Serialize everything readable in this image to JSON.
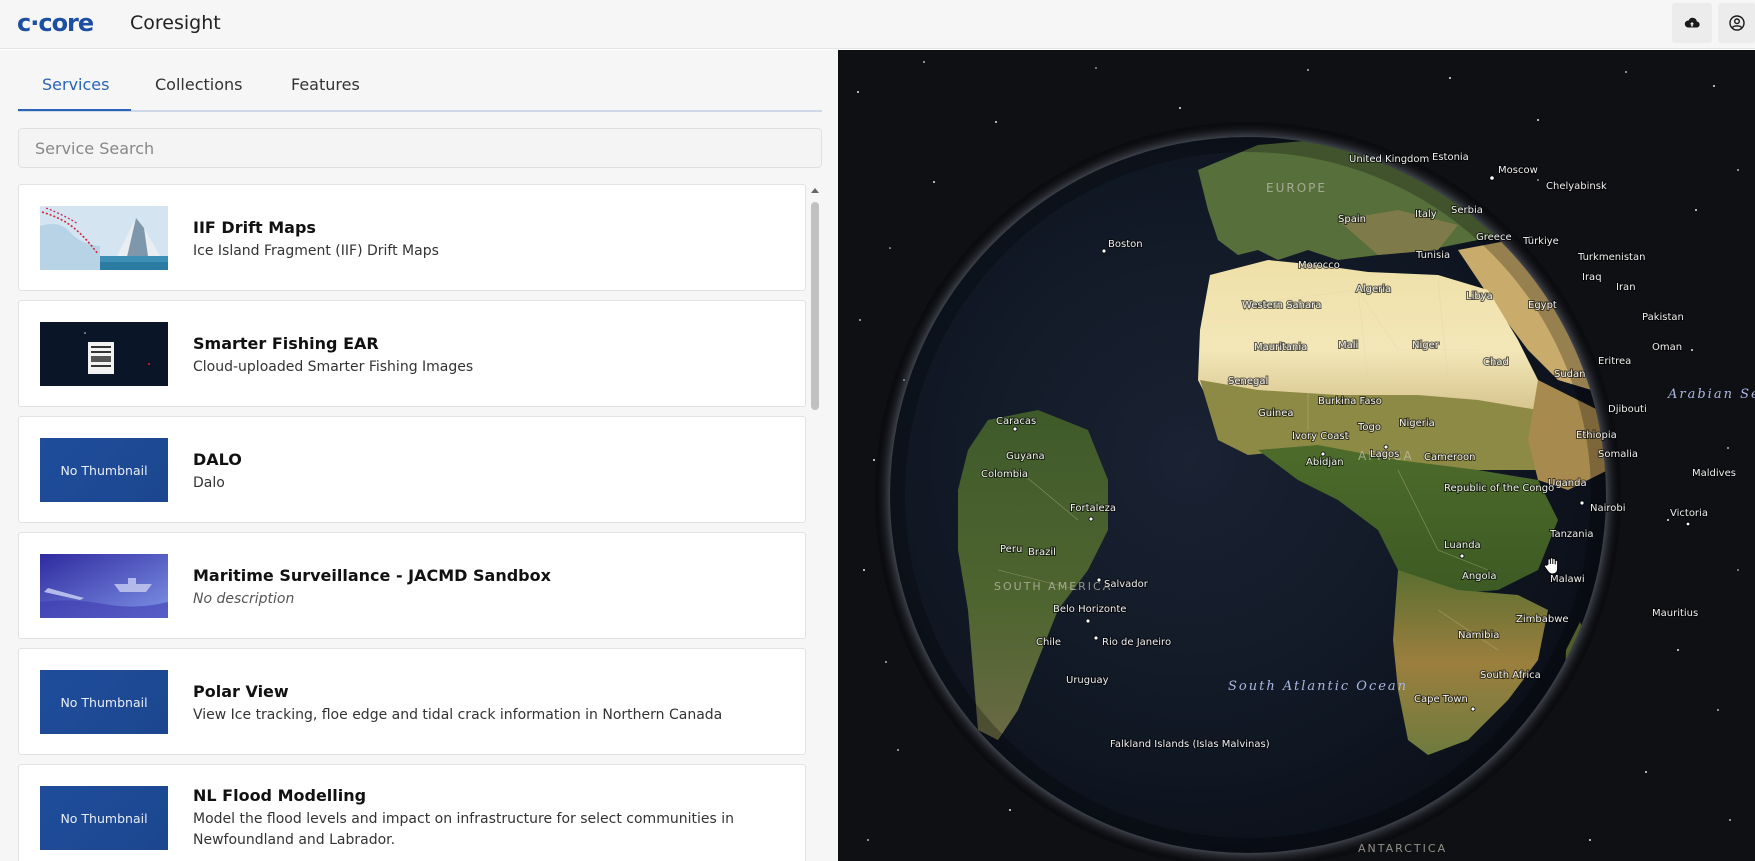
{
  "header": {
    "logo_text": "c·core",
    "app_title": "Coresight",
    "upload_icon": "cloud-upload-icon",
    "account_icon": "user-circle-icon"
  },
  "tabs": [
    {
      "label": "Services",
      "active": true
    },
    {
      "label": "Collections",
      "active": false
    },
    {
      "label": "Features",
      "active": false
    }
  ],
  "search": {
    "placeholder": "Service Search",
    "value": ""
  },
  "services": [
    {
      "title": "IIF Drift Maps",
      "description": "Ice Island Fragment (IIF) Drift Maps",
      "thumbnail": "ice-map",
      "thumbnail_text": ""
    },
    {
      "title": "Smarter Fishing EAR",
      "description": "Cloud-uploaded Smarter Fishing Images",
      "thumbnail": "dark",
      "thumbnail_text": ""
    },
    {
      "title": "DALO",
      "description": "Dalo",
      "thumbnail": "none",
      "thumbnail_text": "No Thumbnail"
    },
    {
      "title": "Maritime Surveillance - JACMD Sandbox",
      "description": "No description",
      "thumbnail": "maritime",
      "thumbnail_text": ""
    },
    {
      "title": "Polar View",
      "description": "View Ice tracking, floe edge and tidal crack information in Northern Canada",
      "thumbnail": "none",
      "thumbnail_text": "No Thumbnail"
    },
    {
      "title": "NL Flood Modelling",
      "description": "Model the flood levels and impact on infrastructure for select communities in Newfoundland and Labrador.",
      "thumbnail": "none",
      "thumbnail_text": "No Thumbnail"
    }
  ],
  "map": {
    "labels": [
      "United Kingdom",
      "Estonia",
      "Moscow",
      "Chelyabinsk",
      "Spain",
      "Italy",
      "Serbia",
      "Greece",
      "Türkiye",
      "Turkmenistan",
      "Boston",
      "Morocco",
      "Tunisia",
      "Iraq",
      "Iran",
      "Algeria",
      "Libya",
      "Egypt",
      "Pakistan",
      "Western Sahara",
      "Mauritania",
      "Mali",
      "Niger",
      "Oman",
      "Chad",
      "Sudan",
      "Eritrea",
      "Senegal",
      "Burkina Faso",
      "Djibouti",
      "Guinea",
      "Nigeria",
      "Togo",
      "Ethiopia",
      "Caracas",
      "Ivory Coast",
      "Lagos",
      "Somalia",
      "Abidjan",
      "Cameroon",
      "Guyana",
      "Colombia",
      "Maldives",
      "Uganda",
      "Republic of the Congo",
      "Nairobi",
      "Victoria",
      "Fortaleza",
      "Tanzania",
      "Peru",
      "Brazil",
      "Luanda",
      "Angola",
      "Malawi",
      "Salvador",
      "Belo Horizonte",
      "Zimbabwe",
      "Mauritius",
      "Chile",
      "Rio de Janeiro",
      "Namibia",
      "Uruguay",
      "South Africa",
      "Cape Town",
      "Falkland Islands (Islas Malvinas)"
    ],
    "region_labels": [
      "EUROPE",
      "AFRICA",
      "SOUTH AMERICA",
      "ANTARCTICA"
    ],
    "ocean_labels": [
      "Arabian Sea",
      "South Atlantic Ocean"
    ]
  }
}
